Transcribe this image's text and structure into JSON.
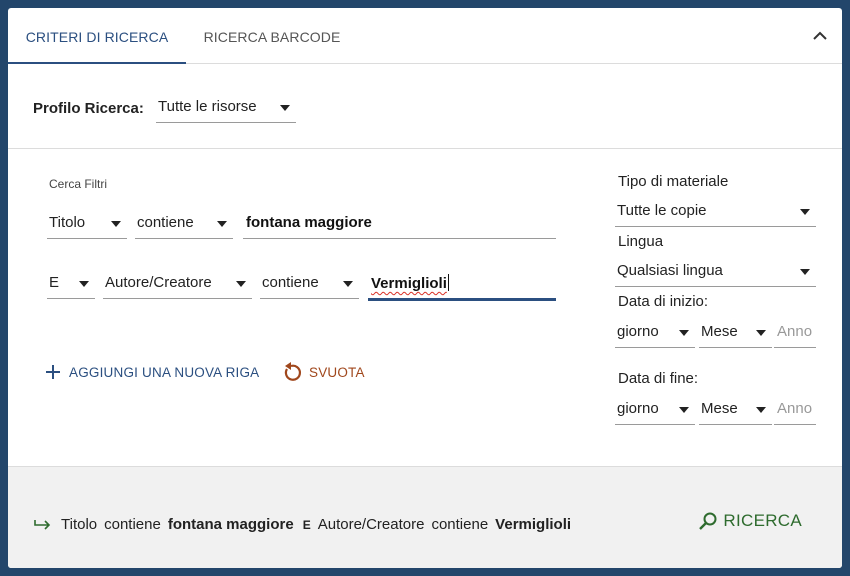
{
  "tabs": [
    {
      "label": "CRITERI DI RICERCA",
      "active": true
    },
    {
      "label": "RICERCA BARCODE",
      "active": false
    }
  ],
  "profile": {
    "label": "Profilo Ricerca:",
    "value": "Tutte le risorse"
  },
  "filters": {
    "section_label": "Cerca Filtri",
    "rows": [
      {
        "field": "Titolo",
        "operator": "contiene",
        "value": "fontana maggiore"
      },
      {
        "conjunction": "E",
        "field": "Autore/Creatore",
        "operator": "contiene",
        "value": "Vermiglioli"
      }
    ]
  },
  "actions": {
    "add_row": "AGGIUNGI UNA NUOVA RIGA",
    "clear": "SVUOTA"
  },
  "side": {
    "material_label": "Tipo di materiale",
    "material_value": "Tutte le copie",
    "language_label": "Lingua",
    "language_value": "Qualsiasi lingua",
    "start_label": "Data di inizio:",
    "end_label": "Data di fine:",
    "day_value": "giorno",
    "month_value": "Mese",
    "year_placeholder": "Anno"
  },
  "summary": {
    "field1": "Titolo",
    "op1": "contiene",
    "value1": "fontana maggiore",
    "conjunction": "E",
    "field2": "Autore/Creatore",
    "op2": "contiene",
    "value2": "Vermiglioli"
  },
  "search_button": "RICERCA",
  "colors": {
    "accent": "#2b4f80",
    "reset": "#a0471c",
    "search": "#2e6b2e",
    "frame": "#23466b"
  }
}
